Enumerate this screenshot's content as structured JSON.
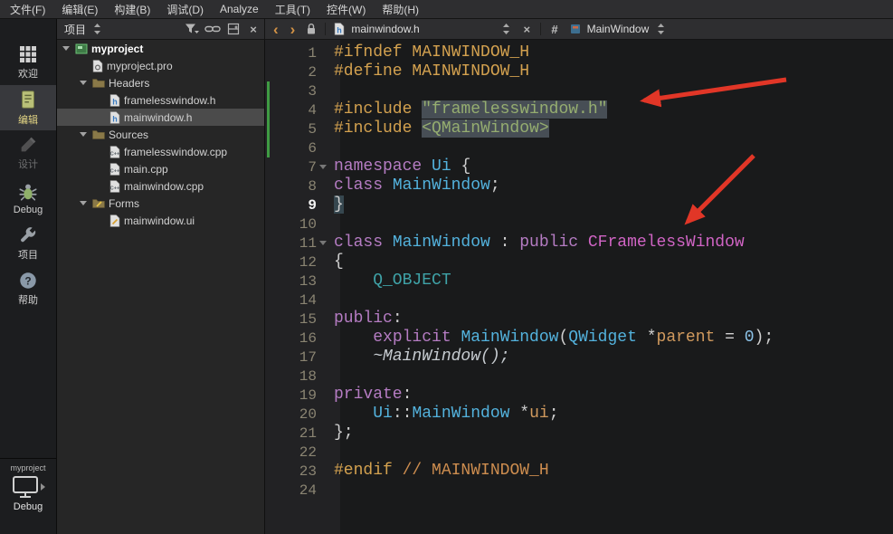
{
  "colors": {
    "arrow_red": "#e13627",
    "change_green": "#3f9b43",
    "selection_gray": "#4b4b4b",
    "accent_gold": "#d3a14f"
  },
  "menu_bar": {
    "items": [
      {
        "id": "file",
        "label": "文件(F)"
      },
      {
        "id": "edit",
        "label": "编辑(E)"
      },
      {
        "id": "build",
        "label": "构建(B)"
      },
      {
        "id": "debug",
        "label": "调试(D)"
      },
      {
        "id": "analyze",
        "label": "Analyze"
      },
      {
        "id": "tools",
        "label": "工具(T)"
      },
      {
        "id": "window",
        "label": "控件(W)"
      },
      {
        "id": "help",
        "label": "帮助(H)"
      }
    ]
  },
  "mode_bar": {
    "items": [
      {
        "id": "welcome",
        "label": "欢迎",
        "icon": "grid-icon",
        "active": false,
        "disabled": false
      },
      {
        "id": "edit",
        "label": "编辑",
        "icon": "edit-icon",
        "active": true,
        "disabled": false
      },
      {
        "id": "design",
        "label": "设计",
        "icon": "design-icon",
        "active": false,
        "disabled": true
      },
      {
        "id": "debug",
        "label": "Debug",
        "icon": "debug-icon",
        "active": false,
        "disabled": false
      },
      {
        "id": "projects",
        "label": "项目",
        "icon": "wrench-icon",
        "active": false,
        "disabled": false
      },
      {
        "id": "help",
        "label": "帮助",
        "icon": "help-icon",
        "active": false,
        "disabled": false
      }
    ],
    "kit_selector": {
      "project": "myproject",
      "config": "Debug"
    }
  },
  "project_panel": {
    "title": "项目",
    "tree": [
      {
        "id": "myproject",
        "label": "myproject",
        "depth": 0,
        "icon": "project-icon",
        "expandable": true,
        "bold": true,
        "selected": false
      },
      {
        "id": "myproject-pro",
        "label": "myproject.pro",
        "depth": 1,
        "icon": "pro-file-icon",
        "expandable": false,
        "selected": false
      },
      {
        "id": "headers",
        "label": "Headers",
        "depth": 1,
        "icon": "folder-icon",
        "expandable": true,
        "selected": false
      },
      {
        "id": "framelesswindow-h",
        "label": "framelesswindow.h",
        "depth": 2,
        "icon": "header-file-icon",
        "expandable": false,
        "selected": false
      },
      {
        "id": "mainwindow-h",
        "label": "mainwindow.h",
        "depth": 2,
        "icon": "header-file-icon",
        "expandable": false,
        "selected": true
      },
      {
        "id": "sources",
        "label": "Sources",
        "depth": 1,
        "icon": "folder-icon",
        "expandable": true,
        "selected": false
      },
      {
        "id": "framelesswindow-cpp",
        "label": "framelesswindow.cpp",
        "depth": 2,
        "icon": "cpp-file-icon",
        "expandable": false,
        "selected": false
      },
      {
        "id": "main-cpp",
        "label": "main.cpp",
        "depth": 2,
        "icon": "cpp-file-icon",
        "expandable": false,
        "selected": false
      },
      {
        "id": "mainwindow-cpp",
        "label": "mainwindow.cpp",
        "depth": 2,
        "icon": "cpp-file-icon",
        "expandable": false,
        "selected": false
      },
      {
        "id": "forms",
        "label": "Forms",
        "depth": 1,
        "icon": "form-folder-icon",
        "expandable": true,
        "selected": false
      },
      {
        "id": "mainwindow-ui",
        "label": "mainwindow.ui",
        "depth": 2,
        "icon": "ui-file-icon",
        "expandable": false,
        "selected": false
      }
    ]
  },
  "editor_toolbar": {
    "open_file": "mainwindow.h",
    "hash_symbol": "#",
    "current_symbol": "MainWindow"
  },
  "editor": {
    "language": "cpp",
    "current_line": 9,
    "lines": [
      {
        "n": 1,
        "tok": [
          [
            "pp",
            "#ifndef MAINWINDOW_H"
          ]
        ]
      },
      {
        "n": 2,
        "tok": [
          [
            "pp",
            "#define MAINWINDOW_H"
          ]
        ]
      },
      {
        "n": 3,
        "tok": [],
        "changed": true
      },
      {
        "n": 4,
        "tok": [
          [
            "pp",
            "#include "
          ],
          [
            "str hl",
            "\"framelesswindow.h\""
          ]
        ],
        "changed": true
      },
      {
        "n": 5,
        "tok": [
          [
            "pp",
            "#include "
          ],
          [
            "str hl",
            "<QMainWindow>"
          ]
        ],
        "changed": true
      },
      {
        "n": 6,
        "tok": [],
        "changed": true
      },
      {
        "n": 7,
        "tok": [
          [
            "kw",
            "namespace "
          ],
          [
            "type",
            "Ui "
          ],
          [
            "pun",
            "{"
          ]
        ],
        "fold": true
      },
      {
        "n": 8,
        "tok": [
          [
            "kw",
            "class "
          ],
          [
            "type",
            "MainWindow"
          ],
          [
            "pun",
            ";"
          ]
        ]
      },
      {
        "n": 9,
        "tok": [
          [
            "pun bracehl",
            "}"
          ]
        ],
        "current": true
      },
      {
        "n": 10,
        "tok": []
      },
      {
        "n": 11,
        "tok": [
          [
            "kw",
            "class "
          ],
          [
            "type",
            "MainWindow "
          ],
          [
            "pun",
            ": "
          ],
          [
            "kw",
            "public "
          ],
          [
            "cls",
            "CFramelessWindow"
          ]
        ],
        "fold": true
      },
      {
        "n": 12,
        "tok": [
          [
            "pun",
            "{"
          ]
        ]
      },
      {
        "n": 13,
        "tok": [
          [
            "macro",
            "    Q_OBJECT"
          ]
        ]
      },
      {
        "n": 14,
        "tok": []
      },
      {
        "n": 15,
        "tok": [
          [
            "kw",
            "public"
          ],
          [
            "pun",
            ":"
          ]
        ]
      },
      {
        "n": 16,
        "tok": [
          [
            "pun",
            "    "
          ],
          [
            "kw",
            "explicit "
          ],
          [
            "type",
            "MainWindow"
          ],
          [
            "pun",
            "("
          ],
          [
            "type",
            "QWidget "
          ],
          [
            "pun",
            "*"
          ],
          [
            "arg",
            "parent"
          ],
          [
            "pun",
            " = "
          ],
          [
            "num",
            "0"
          ],
          [
            "pun",
            ");"
          ]
        ]
      },
      {
        "n": 17,
        "tok": [
          [
            "pun",
            "    "
          ],
          [
            "dtor",
            "~MainWindow();"
          ]
        ]
      },
      {
        "n": 18,
        "tok": []
      },
      {
        "n": 19,
        "tok": [
          [
            "kw",
            "private"
          ],
          [
            "pun",
            ":"
          ]
        ]
      },
      {
        "n": 20,
        "tok": [
          [
            "pun",
            "    "
          ],
          [
            "type",
            "Ui"
          ],
          [
            "pun",
            "::"
          ],
          [
            "type",
            "MainWindow "
          ],
          [
            "pun",
            "*"
          ],
          [
            "arg",
            "ui"
          ],
          [
            "pun",
            ";"
          ]
        ]
      },
      {
        "n": 21,
        "tok": [
          [
            "pun",
            "};"
          ]
        ]
      },
      {
        "n": 22,
        "tok": []
      },
      {
        "n": 23,
        "tok": [
          [
            "pp",
            "#endif "
          ],
          [
            "cmt",
            "// MAINWINDOW_H"
          ]
        ]
      },
      {
        "n": 24,
        "tok": []
      }
    ]
  }
}
